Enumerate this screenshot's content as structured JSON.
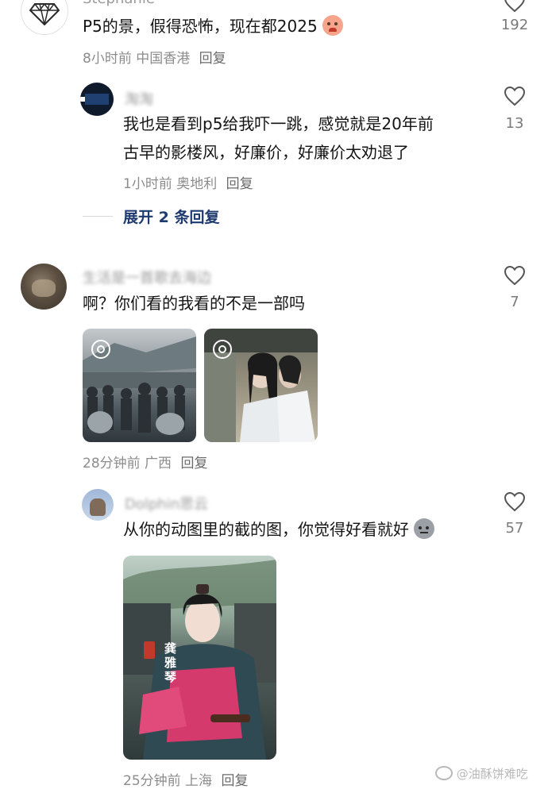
{
  "comments": [
    {
      "name": "Stephanie",
      "text": "P5的景，假得恐怖，现在都2025",
      "time": "8小时前",
      "location": "中国香港",
      "reply": "回复",
      "likes": "192",
      "emoji": "crying-face"
    },
    {
      "name": "淘淘",
      "text_line1": "我也是看到p5给我吓一跳，感觉就是20年前",
      "text_line2": "古早的影楼风，好廉价，好廉价太劝退了",
      "time": "1小时前",
      "location": "奥地利",
      "reply": "回复",
      "likes": "13"
    },
    {
      "expand_label": "展开 2 条回复"
    },
    {
      "name": "生活是一首歌去海边",
      "text": "啊？你们看的我看的不是一部吗",
      "time": "28分钟前",
      "location": "广西",
      "reply": "回复",
      "likes": "7"
    },
    {
      "name": "Dolphin思云",
      "text": "从你的动图里的截的图，你觉得好看就好",
      "time": "25分钟前",
      "location": "上海",
      "reply": "回复",
      "likes": "57",
      "photo_caption": "龚雅琴",
      "emoji": "sweat-face"
    }
  ],
  "watermark": "@油酥饼难吃",
  "colors": {
    "text": "#141414",
    "meta": "#8c8c8c",
    "expand": "#1f3a6e"
  }
}
